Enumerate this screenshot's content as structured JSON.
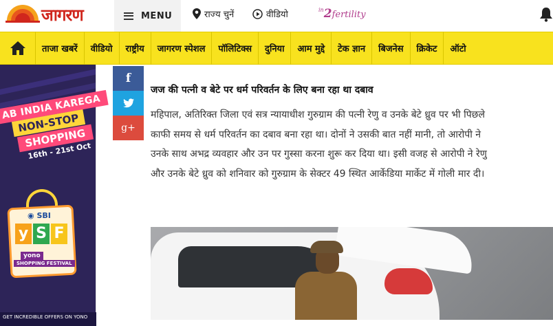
{
  "header": {
    "logo_text": "जागरण",
    "menu_label": "MENU",
    "state_link": "राज्य चुनें",
    "video_link": "वीडियो",
    "partner_logo_in": "in",
    "partner_logo_num": "2",
    "partner_logo_word": "fertility",
    "accent_color": "#d0261d",
    "icons": [
      "hamburger-icon",
      "location-pin-icon",
      "play-circle-icon",
      "bell-icon"
    ]
  },
  "nav": {
    "home_icon": "home-icon",
    "items": [
      "ताजा खबरें",
      "वीडियो",
      "राष्ट्रीय",
      "जागरण स्पेशल",
      "पॉलिटिक्स",
      "दुनिया",
      "आम मुद्दे",
      "टेक ज्ञान",
      "बिजनेस",
      "क्रिकेट",
      "ऑटो"
    ],
    "background": "#f8e21e"
  },
  "ad": {
    "line1": "AB INDIA KAREGA",
    "line2": "NON-STOP",
    "line3": "SHOPPING",
    "dates": "16th - 21st Oct",
    "bank": "SBI",
    "ysf": [
      "y",
      "S",
      "F"
    ],
    "brand": "yono",
    "festival": "SHOPPING FESTIVAL",
    "footer": "GET INCREDIBLE OFFERS ON YONO"
  },
  "share": {
    "facebook": "f",
    "twitter": "twitter-bird-icon",
    "google": "g+"
  },
  "article": {
    "headline": "जज की पत्नी व बेटे पर धर्म परिवर्तन के लिए बना रहा था दबाव",
    "lines": [
      "महिपाल, अतिरिक्त जिला एवं सत्र न्यायाधीश गुरुग्राम की पत्नी रेणु व उनके बेटे ध्रुव पर भी पिछले",
      "काफी समय से धर्म परिवर्तन का दबाव बना रहा था। दोनों ने उसकी बात नहीं मानी, तो आरोपी ने",
      "उनके साथ अभद्र व्यवहार और उन पर गुस्सा करना शुरू कर दिया था। इसी वजह से आरोपी ने रेणु",
      "और उनके बेटे ध्रुव को शनिवार को गुरुग्राम के सेक्टर 49 स्थित आर्केडिया मार्केट में गोली मार दी।"
    ]
  }
}
